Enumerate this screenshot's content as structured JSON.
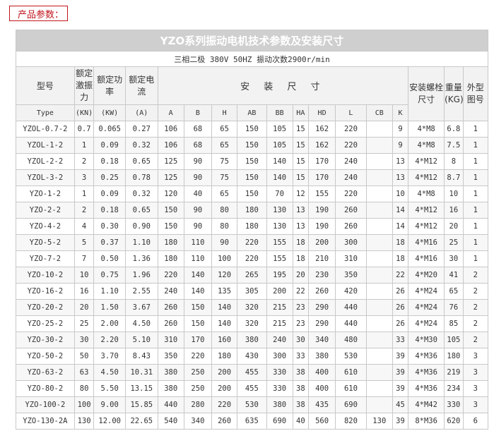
{
  "tag_label": "产品参数：",
  "table": {
    "title": "YZO系列振动电机技术参数及安装尺寸",
    "subtitle": "三相二极 380V 50HZ 振动次数2900r/min",
    "header": {
      "model": "型号",
      "force": "额定激振力",
      "power": "额定功率",
      "current": "额定电流",
      "install_group": "安 装 尺 寸",
      "bolt": "安装螺栓尺寸",
      "weight": "重量(KG)",
      "outline": "外型图号"
    },
    "subheader": [
      "Type",
      "(KN)",
      "(KW)",
      "(A)",
      "A",
      "B",
      "H",
      "AB",
      "BB",
      "HA",
      "HD",
      "L",
      "CB",
      "K",
      "",
      "",
      ""
    ],
    "rows": [
      [
        "YZOL-0.7-2",
        "0.7",
        "0.065",
        "0.27",
        "106",
        "68",
        "65",
        "150",
        "105",
        "15",
        "162",
        "220",
        "",
        "9",
        "4*M8",
        "6.8",
        "1"
      ],
      [
        "YZOL-1-2",
        "1",
        "0.09",
        "0.32",
        "106",
        "68",
        "65",
        "150",
        "105",
        "15",
        "162",
        "220",
        "",
        "9",
        "4*M8",
        "7.5",
        "1"
      ],
      [
        "YZOL-2-2",
        "2",
        "0.18",
        "0.65",
        "125",
        "90",
        "75",
        "150",
        "140",
        "15",
        "170",
        "240",
        "",
        "13",
        "4*M12",
        "8",
        "1"
      ],
      [
        "YZOL-3-2",
        "3",
        "0.25",
        "0.78",
        "125",
        "90",
        "75",
        "150",
        "140",
        "15",
        "170",
        "240",
        "",
        "13",
        "4*M12",
        "8.7",
        "1"
      ],
      [
        "YZO-1-2",
        "1",
        "0.09",
        "0.32",
        "120",
        "40",
        "65",
        "150",
        "70",
        "12",
        "155",
        "220",
        "",
        "10",
        "4*M8",
        "10",
        "1"
      ],
      [
        "YZO-2-2",
        "2",
        "0.18",
        "0.65",
        "150",
        "90",
        "80",
        "180",
        "130",
        "13",
        "190",
        "260",
        "",
        "14",
        "4*M12",
        "16",
        "1"
      ],
      [
        "YZO-4-2",
        "4",
        "0.30",
        "0.90",
        "150",
        "90",
        "80",
        "180",
        "130",
        "13",
        "190",
        "260",
        "",
        "14",
        "4*M12",
        "20",
        "1"
      ],
      [
        "YZO-5-2",
        "5",
        "0.37",
        "1.10",
        "180",
        "110",
        "90",
        "220",
        "155",
        "18",
        "200",
        "300",
        "",
        "18",
        "4*M16",
        "25",
        "1"
      ],
      [
        "YZO-7-2",
        "7",
        "0.50",
        "1.36",
        "180",
        "110",
        "100",
        "220",
        "155",
        "18",
        "210",
        "310",
        "",
        "18",
        "4*M16",
        "30",
        "1"
      ],
      [
        "YZO-10-2",
        "10",
        "0.75",
        "1.96",
        "220",
        "140",
        "120",
        "265",
        "195",
        "20",
        "230",
        "350",
        "",
        "22",
        "4*M20",
        "41",
        "2"
      ],
      [
        "YZO-16-2",
        "16",
        "1.10",
        "2.55",
        "240",
        "140",
        "135",
        "305",
        "200",
        "22",
        "260",
        "420",
        "",
        "26",
        "4*M24",
        "65",
        "2"
      ],
      [
        "YZO-20-2",
        "20",
        "1.50",
        "3.67",
        "260",
        "150",
        "140",
        "320",
        "215",
        "23",
        "290",
        "440",
        "",
        "26",
        "4*M24",
        "76",
        "2"
      ],
      [
        "YZO-25-2",
        "25",
        "2.00",
        "4.50",
        "260",
        "150",
        "140",
        "320",
        "215",
        "23",
        "290",
        "440",
        "",
        "26",
        "4*M24",
        "85",
        "2"
      ],
      [
        "YZO-30-2",
        "30",
        "2.20",
        "5.10",
        "310",
        "170",
        "160",
        "380",
        "240",
        "30",
        "340",
        "480",
        "",
        "33",
        "4*M30",
        "105",
        "2"
      ],
      [
        "YZO-50-2",
        "50",
        "3.70",
        "8.43",
        "350",
        "220",
        "180",
        "430",
        "300",
        "33",
        "380",
        "530",
        "",
        "39",
        "4*M36",
        "180",
        "3"
      ],
      [
        "YZO-63-2",
        "63",
        "4.50",
        "10.31",
        "380",
        "250",
        "200",
        "455",
        "330",
        "38",
        "400",
        "610",
        "",
        "39",
        "4*M36",
        "219",
        "3"
      ],
      [
        "YZO-80-2",
        "80",
        "5.50",
        "13.15",
        "380",
        "250",
        "200",
        "455",
        "330",
        "38",
        "400",
        "610",
        "",
        "39",
        "4*M36",
        "234",
        "3"
      ],
      [
        "YZO-100-2",
        "100",
        "9.00",
        "15.85",
        "440",
        "280",
        "220",
        "530",
        "380",
        "38",
        "435",
        "690",
        "",
        "45",
        "4*M42",
        "330",
        "3"
      ],
      [
        "YZO-130-2A",
        "130",
        "12.00",
        "22.65",
        "540",
        "340",
        "260",
        "635",
        "690",
        "40",
        "560",
        "820",
        "130",
        "39",
        "8*M36",
        "620",
        "6"
      ]
    ]
  }
}
